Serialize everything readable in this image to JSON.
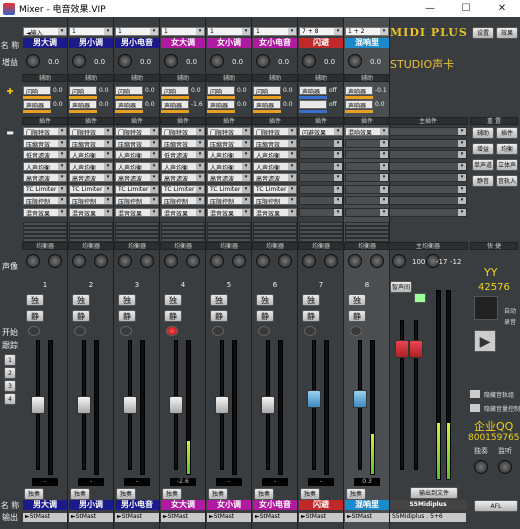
{
  "window": {
    "title": "Mixer - 电音效果.VIP",
    "minimize": "—",
    "maximize": "☐",
    "close": "✕"
  },
  "row_labels": {
    "name": "名 称",
    "gain": "增益",
    "send": "辅助",
    "insert": "插 件",
    "pan": "声像",
    "start": "开始",
    "track": "跟踪",
    "output": "输出",
    "name2": "名 称"
  },
  "section_labels": {
    "aux": "辅助",
    "plugin": "插件",
    "eq": "均衡器",
    "master_plugin": "主插件",
    "reset": "重 置",
    "master_eq": "主均衡器",
    "fast": "快 捷"
  },
  "strips": [
    {
      "input": "◄输入",
      "num": "1",
      "name": "男大调",
      "name_color": "#1a1a8a",
      "gain": "0.0",
      "sends": [
        {
          "n": "闪响",
          "v": "0.0",
          "c": "#e8a020"
        },
        {
          "n": "声响器",
          "v": "0.0",
          "c": "#e8a020"
        }
      ],
      "plugins": [
        "门限特效",
        "压缩音效",
        "低音滤波",
        "人声均衡",
        "高音滤波",
        "TC Limiter",
        "压限控制",
        "混音效果"
      ],
      "eq": "均衡器",
      "pan": "0",
      "chan": "1",
      "solo": "独",
      "mute": "静",
      "rec": false,
      "fader": 0.5,
      "meter": 0,
      "db": "-",
      "out": "►StMast",
      "sub": "独奏"
    },
    {
      "input": "1",
      "num": "1",
      "name": "男小调",
      "name_color": "#1a1a8a",
      "gain": "0.0",
      "sends": [
        {
          "n": "闪响",
          "v": "0.0",
          "c": "#e8a020"
        },
        {
          "n": "声响器",
          "v": "0.0",
          "c": "#e8a020"
        }
      ],
      "plugins": [
        "门限特效",
        "压缩音效",
        "人声均衡",
        "人声均衡",
        "高音滤波",
        "TC Limiter",
        "压限控制",
        "混音效果"
      ],
      "eq": "均衡器",
      "pan": "0",
      "chan": "2",
      "solo": "独",
      "mute": "静",
      "rec": false,
      "fader": 0.5,
      "meter": 0,
      "db": "-",
      "out": "►StMast",
      "sub": "独奏"
    },
    {
      "input": "1",
      "num": "1",
      "name": "男小电音",
      "name_color": "#1a1a8a",
      "gain": "0.0",
      "sends": [
        {
          "n": "闪响",
          "v": "0.0",
          "c": "#e8a020"
        },
        {
          "n": "声响器",
          "v": "0.0",
          "c": "#e8a020"
        }
      ],
      "plugins": [
        "门限特效",
        "压缩音效",
        "人声均衡",
        "人声均衡",
        "高音滤波",
        "TC Limiter",
        "压限控制",
        "混音效果"
      ],
      "eq": "均衡器",
      "pan": "0",
      "chan": "3",
      "solo": "独",
      "mute": "静",
      "rec": false,
      "fader": 0.5,
      "meter": 0,
      "db": "-",
      "out": "►StMast",
      "sub": "独奏"
    },
    {
      "input": "1",
      "num": "1",
      "name": "女大调",
      "name_color": "#b01aa0",
      "gain": "0.0",
      "sends": [
        {
          "n": "闪响",
          "v": "0.0",
          "c": "#e8a020"
        },
        {
          "n": "声响器",
          "v": "-1.6",
          "c": "#e8a020"
        }
      ],
      "plugins": [
        "门限特效",
        "压缩音效",
        "低音滤波",
        "人声均衡",
        "高音滤波",
        "TC Limiter",
        "压限控制",
        "混音效果"
      ],
      "eq": "均衡器",
      "pan": "0",
      "chan": "4",
      "solo": "独",
      "mute": "静",
      "rec": true,
      "fader": 0.5,
      "meter": 0.25,
      "db": "-2.6",
      "out": "►StMast",
      "sub": "独奏"
    },
    {
      "input": "1",
      "num": "1",
      "name": "女小调",
      "name_color": "#b01aa0",
      "gain": "0.0",
      "sends": [
        {
          "n": "闪响",
          "v": "0.0",
          "c": "#e8a020"
        },
        {
          "n": "声响器",
          "v": "0.0",
          "c": "#e8a020"
        }
      ],
      "plugins": [
        "门限特效",
        "压缩音效",
        "人声均衡",
        "人声均衡",
        "高音滤波",
        "TC Limiter",
        "压限控制",
        "混音效果"
      ],
      "eq": "均衡器",
      "pan": "0",
      "chan": "5",
      "solo": "独",
      "mute": "静",
      "rec": false,
      "fader": 0.5,
      "meter": 0,
      "db": "-",
      "out": "►StMast",
      "sub": "独奏"
    },
    {
      "input": "1",
      "num": "1",
      "name": "女小电音",
      "name_color": "#b01aa0",
      "gain": "0.0",
      "sends": [
        {
          "n": "闪响",
          "v": "0.0",
          "c": "#e8a020"
        },
        {
          "n": "声响器",
          "v": "0.0",
          "c": "#e8a020"
        }
      ],
      "plugins": [
        "门限特效",
        "压缩音效",
        "人声均衡",
        "人声均衡",
        "高音滤波",
        "TC Limiter",
        "压限控制",
        "混音效果"
      ],
      "eq": "均衡器",
      "pan": "0",
      "chan": "6",
      "solo": "独",
      "mute": "静",
      "rec": false,
      "fader": 0.5,
      "meter": 0,
      "db": "-",
      "out": "►StMast",
      "sub": "独奏"
    },
    {
      "input": "7 + 8",
      "num": "7",
      "name": "闪避",
      "name_color": "#c0282a",
      "gain": "0.0",
      "sends": [
        {
          "n": "声响器",
          "v": "off",
          "c": "#3a6fd0"
        },
        {
          "n": "",
          "v": "off",
          "c": "#3a6fd0"
        }
      ],
      "plugins": [
        "闪避效果",
        "",
        "",
        "",
        "",
        "",
        "",
        ""
      ],
      "eq": "均衡器",
      "pan": "0",
      "chan": "7",
      "solo": "独",
      "mute": "静",
      "rec": false,
      "fader": 0.55,
      "meter": 0,
      "db": "-",
      "out": "►StMast",
      "sub": "独奏"
    },
    {
      "input": "1 + 2",
      "num": "8",
      "name": "混响里",
      "name_color": "#1a8ac8",
      "gain": "0.0",
      "sends": [
        {
          "n": "声响器",
          "v": "-0.1",
          "c": "#e8a020"
        },
        {
          "n": "声响器",
          "v": "0.0",
          "c": "#e8a020"
        }
      ],
      "plugins": [
        "混响效果",
        "",
        "",
        "",
        "",
        "",
        "",
        ""
      ],
      "eq": "均衡器",
      "pan": "0",
      "chan": "8",
      "solo": "独",
      "mute": "静",
      "rec": false,
      "fader": 0.55,
      "meter": 0.3,
      "db": "0.3",
      "out": "►StMast",
      "sub": "独奏"
    }
  ],
  "master": {
    "brand": "MIDI PLUS",
    "studio": "STUDIO声卡",
    "setting": "设置",
    "fx": "效果",
    "pan": "0",
    "ch": "100",
    "eq": "主均衡器",
    "label": "智声间",
    "out": "输出到文件",
    "smidi": "S5Midiplus",
    "db": [
      "-17",
      "-12"
    ],
    "outs": [
      "►StMast",
      "►1 + 2"
    ],
    "bottom_out": "S5Midiplus . 5+6"
  },
  "right": {
    "buttons": [
      "辅助",
      "插件",
      "增益",
      "均衡",
      "单声道",
      "立体声",
      "静音",
      "音轨入"
    ],
    "yy": "YY",
    "yy_num": "42576",
    "auto": "自动",
    "auto2": "录音",
    "qq": "企业QQ",
    "qq_num": "800159765",
    "check1": "隐藏音轨组",
    "check2": "隐藏音量控制",
    "sub1": "独奏",
    "sub2": "监听",
    "afl": "AFL"
  },
  "track_btns": [
    "1",
    "2",
    "3",
    "4"
  ]
}
